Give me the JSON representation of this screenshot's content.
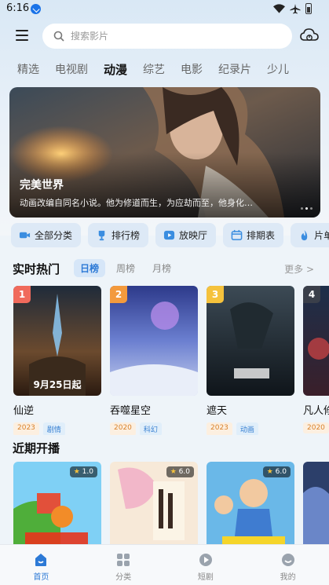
{
  "status_bar": {
    "time": "6:16"
  },
  "search": {
    "placeholder": "搜索影片"
  },
  "tabs": [
    {
      "label": "精选"
    },
    {
      "label": "电视剧"
    },
    {
      "label": "动漫",
      "active": true
    },
    {
      "label": "综艺"
    },
    {
      "label": "电影"
    },
    {
      "label": "纪录片"
    },
    {
      "label": "少儿"
    }
  ],
  "banner": {
    "title": "完美世界",
    "description": "动画改编自同名小说。他为修道而生，为应劫而至，他身化…"
  },
  "quick_buttons": [
    {
      "label": "全部分类",
      "icon": "video-camera-icon"
    },
    {
      "label": "排行榜",
      "icon": "trophy-icon"
    },
    {
      "label": "放映厅",
      "icon": "play-screen-icon"
    },
    {
      "label": "排期表",
      "icon": "calendar-icon"
    },
    {
      "label": "片单",
      "icon": "flame-icon"
    }
  ],
  "hot": {
    "title": "实时热门",
    "tabs": [
      "日榜",
      "周榜",
      "月榜"
    ],
    "more": "更多 >",
    "items": [
      {
        "rank": "1",
        "title": "仙逆",
        "year": "2023",
        "genre": "剧情",
        "overlay": "9月25日起"
      },
      {
        "rank": "2",
        "title": "吞噬星空",
        "year": "2020",
        "genre": "科幻",
        "overlay": ""
      },
      {
        "rank": "3",
        "title": "遮天",
        "year": "2023",
        "genre": "动画",
        "overlay": ""
      },
      {
        "rank": "4",
        "title": "凡人修仙传",
        "year": "2020",
        "genre": "",
        "overlay": ""
      }
    ]
  },
  "upcoming": {
    "title": "近期开播",
    "items": [
      {
        "score": "1.0"
      },
      {
        "score": "6.0"
      },
      {
        "score": "6.0"
      },
      {
        "score": ""
      }
    ]
  },
  "bottom_nav": [
    {
      "label": "首页",
      "active": true
    },
    {
      "label": "分类"
    },
    {
      "label": "短剧"
    },
    {
      "label": "我的"
    }
  ],
  "colors": {
    "accent": "#2d7ad6",
    "rank1": "#f06a5c",
    "rank2": "#f39a3d",
    "rank3": "#f5c23c",
    "rank4": "#3a3f4a"
  }
}
